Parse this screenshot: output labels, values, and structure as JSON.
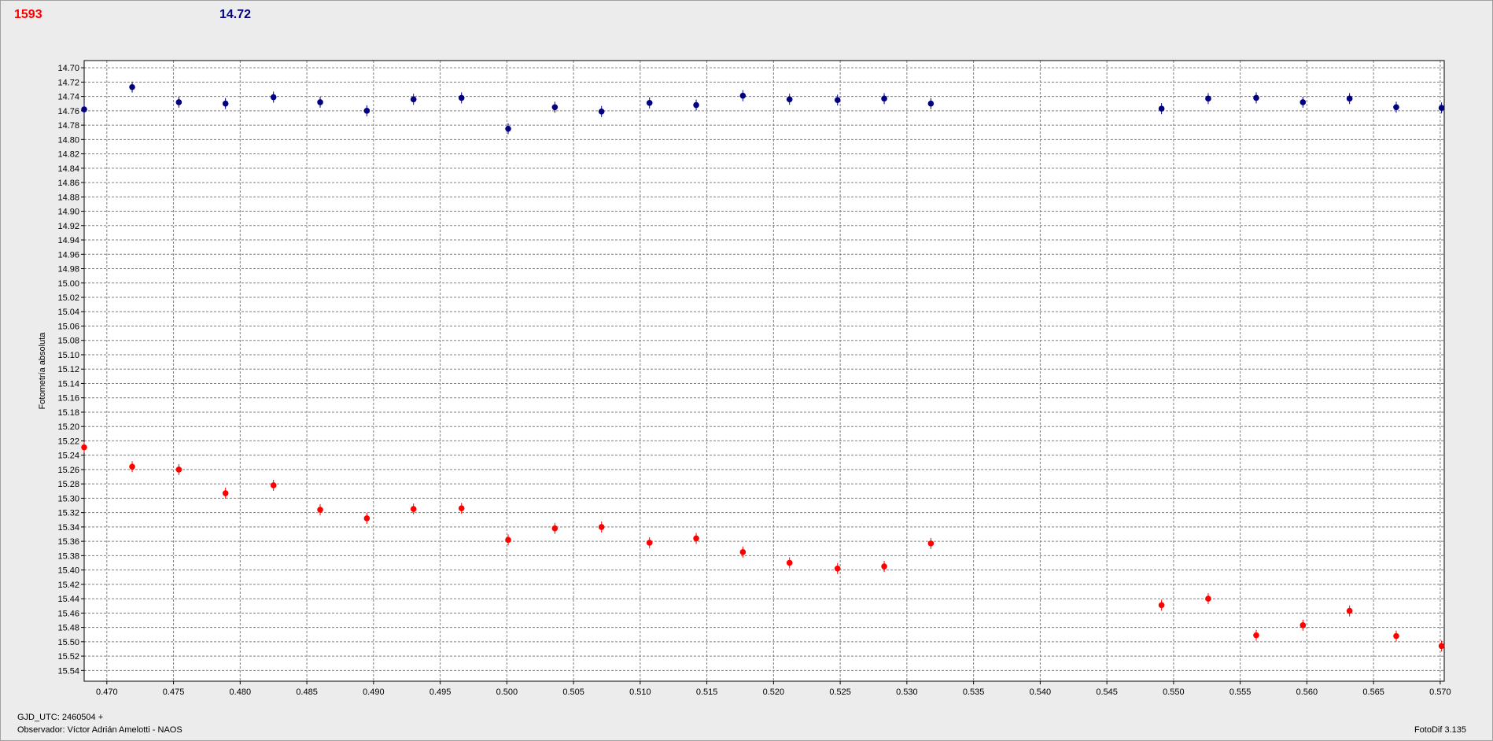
{
  "header": {
    "left_value": "1593",
    "right_value": "14.72",
    "left_color": "#ff0000",
    "right_color": "#000080"
  },
  "footer": {
    "gjd": "GJD_UTC: 2460504 +",
    "observer": "Observador: Víctor Adrián Amelotti - NAOS",
    "software": "FotoDif 3.135"
  },
  "chart_data": {
    "type": "scatter",
    "ylabel": "Fotometría absoluta",
    "xlabel": "GJD_UTC: 2460504 +",
    "xlim": [
      0.4683,
      0.5703
    ],
    "ylim": [
      14.69,
      15.555
    ],
    "y_inverted": true,
    "grid": true,
    "x_ticks": [
      "0.470",
      "0.475",
      "0.480",
      "0.485",
      "0.490",
      "0.495",
      "0.500",
      "0.505",
      "0.510",
      "0.515",
      "0.520",
      "0.525",
      "0.530",
      "0.535",
      "0.540",
      "0.545",
      "0.550",
      "0.555",
      "0.560",
      "0.565",
      "0.570"
    ],
    "y_ticks": [
      "14.70",
      "14.72",
      "14.74",
      "14.76",
      "14.78",
      "14.80",
      "14.82",
      "14.84",
      "14.86",
      "14.88",
      "14.90",
      "14.92",
      "14.94",
      "14.96",
      "14.98",
      "15.00",
      "15.02",
      "15.04",
      "15.06",
      "15.08",
      "15.10",
      "15.12",
      "15.14",
      "15.16",
      "15.18",
      "15.20",
      "15.22",
      "15.24",
      "15.26",
      "15.28",
      "15.30",
      "15.32",
      "15.34",
      "15.36",
      "15.38",
      "15.40",
      "15.42",
      "15.44",
      "15.46",
      "15.48",
      "15.50",
      "15.52",
      "15.54"
    ],
    "series": [
      {
        "color": "#000080",
        "x": [
          0.4683,
          0.4719,
          0.4754,
          0.4789,
          0.4825,
          0.486,
          0.4895,
          0.493,
          0.4966,
          0.5001,
          0.5036,
          0.5071,
          0.5107,
          0.5142,
          0.5177,
          0.5212,
          0.5248,
          0.5283,
          0.5318,
          0.5491,
          0.5526,
          0.5562,
          0.5597,
          0.5632,
          0.5667,
          0.5701
        ],
        "y": [
          14.758,
          14.727,
          14.748,
          14.75,
          14.741,
          14.748,
          14.76,
          14.744,
          14.742,
          14.785,
          14.755,
          14.761,
          14.749,
          14.752,
          14.739,
          14.744,
          14.745,
          14.743,
          14.75,
          14.757,
          14.743,
          14.742,
          14.748,
          14.743,
          14.755,
          14.756
        ]
      },
      {
        "color": "#ff0000",
        "x": [
          0.4683,
          0.4719,
          0.4754,
          0.4789,
          0.4825,
          0.486,
          0.4895,
          0.493,
          0.4966,
          0.5001,
          0.5036,
          0.5071,
          0.5107,
          0.5142,
          0.5177,
          0.5212,
          0.5248,
          0.5283,
          0.5318,
          0.5491,
          0.5526,
          0.5562,
          0.5597,
          0.5632,
          0.5667,
          0.5701
        ],
        "y": [
          15.229,
          15.256,
          15.26,
          15.293,
          15.282,
          15.316,
          15.328,
          15.315,
          15.314,
          15.358,
          15.342,
          15.34,
          15.362,
          15.356,
          15.375,
          15.39,
          15.398,
          15.395,
          15.363,
          15.449,
          15.44,
          15.491,
          15.477,
          15.457,
          15.492,
          15.506
        ]
      }
    ]
  }
}
